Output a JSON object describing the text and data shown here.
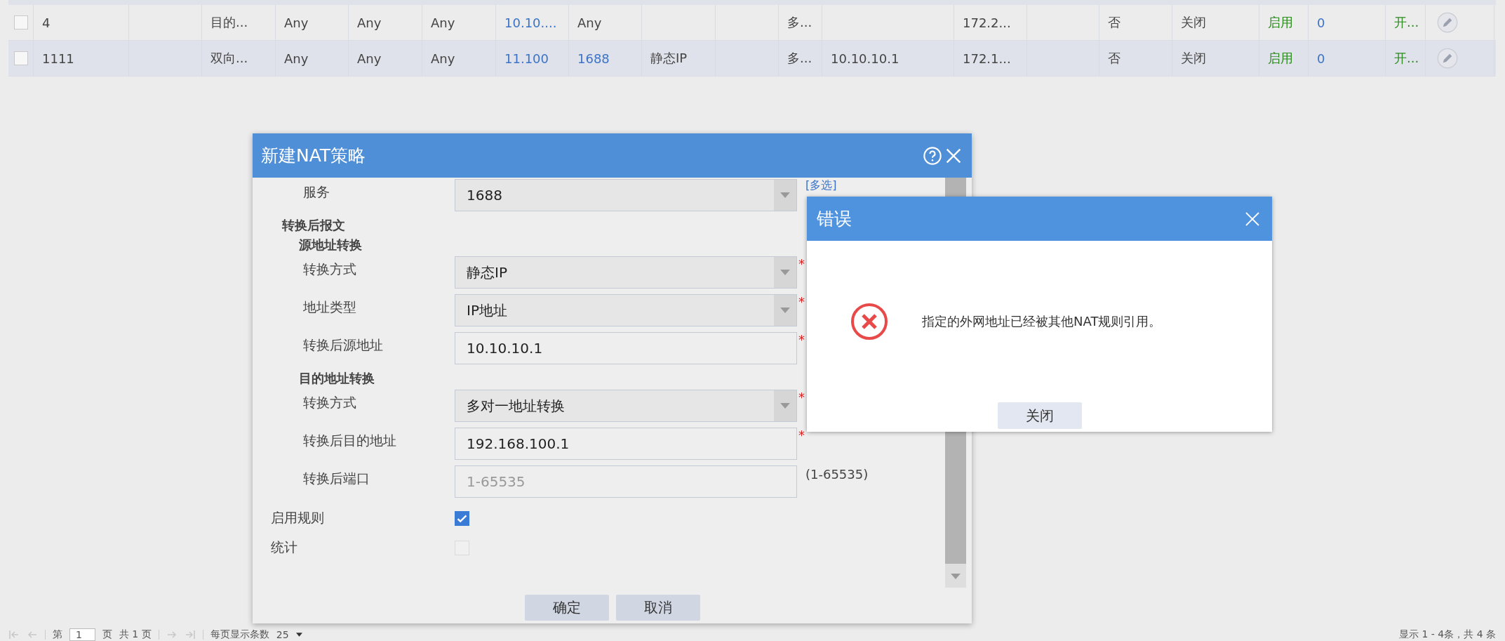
{
  "table": {
    "rows": [
      {
        "selected": false,
        "checked": false,
        "cells": [
          {
            "kind": "text",
            "text": "4"
          },
          {
            "kind": "text",
            "text": ""
          },
          {
            "kind": "text",
            "text": "目的..."
          },
          {
            "kind": "text",
            "text": "Any"
          },
          {
            "kind": "text",
            "text": "Any"
          },
          {
            "kind": "text",
            "text": "Any"
          },
          {
            "kind": "link",
            "text": "10.10...."
          },
          {
            "kind": "text",
            "text": "Any"
          },
          {
            "kind": "text",
            "text": ""
          },
          {
            "kind": "text",
            "text": ""
          },
          {
            "kind": "text",
            "text": "多..."
          },
          {
            "kind": "text",
            "text": ""
          },
          {
            "kind": "text",
            "text": "172.2..."
          },
          {
            "kind": "text",
            "text": ""
          },
          {
            "kind": "text",
            "text": "否"
          },
          {
            "kind": "text",
            "text": "关闭"
          },
          {
            "kind": "status",
            "text": "启用"
          },
          {
            "kind": "link",
            "text": "0"
          },
          {
            "kind": "status",
            "text": "开..."
          },
          {
            "kind": "edit"
          }
        ]
      },
      {
        "selected": true,
        "checked": false,
        "cells": [
          {
            "kind": "text",
            "text": "1111"
          },
          {
            "kind": "text",
            "text": ""
          },
          {
            "kind": "text",
            "text": "双向..."
          },
          {
            "kind": "text",
            "text": "Any"
          },
          {
            "kind": "text",
            "text": "Any"
          },
          {
            "kind": "text",
            "text": "Any"
          },
          {
            "kind": "link",
            "text": "11.100"
          },
          {
            "kind": "link",
            "text": "1688"
          },
          {
            "kind": "text",
            "text": "静态IP"
          },
          {
            "kind": "text",
            "text": ""
          },
          {
            "kind": "text",
            "text": "多..."
          },
          {
            "kind": "text",
            "text": "10.10.10.1"
          },
          {
            "kind": "text",
            "text": "172.1..."
          },
          {
            "kind": "text",
            "text": ""
          },
          {
            "kind": "text",
            "text": "否"
          },
          {
            "kind": "text",
            "text": "关闭"
          },
          {
            "kind": "status",
            "text": "启用"
          },
          {
            "kind": "link",
            "text": "0"
          },
          {
            "kind": "status",
            "text": "开..."
          },
          {
            "kind": "edit"
          }
        ]
      }
    ]
  },
  "nat_dialog": {
    "title": "新建NAT策略",
    "fields": [
      {
        "kind": "select",
        "label": "服务",
        "value": "1688",
        "link": "[多选]"
      },
      {
        "kind": "section",
        "label": "转换后报文"
      },
      {
        "kind": "subsection",
        "label": "源地址转换"
      },
      {
        "kind": "select",
        "label": "转换方式",
        "value": "静态IP",
        "required_mark": "*"
      },
      {
        "kind": "select",
        "label": "地址类型",
        "value": "IP地址",
        "required_mark": "*"
      },
      {
        "kind": "input",
        "label": "转换后源地址",
        "value": "10.10.10.1",
        "required_mark": "*"
      },
      {
        "kind": "subsection",
        "label": "目的地址转换"
      },
      {
        "kind": "select",
        "label": "转换方式",
        "value": "多对一地址转换",
        "required_mark": "*"
      },
      {
        "kind": "input",
        "label": "转换后目的地址",
        "value": "192.168.100.1",
        "required_mark": "*"
      },
      {
        "kind": "input",
        "label": "转换后端口",
        "placeholder": "1-65535",
        "note": "(1-65535)"
      },
      {
        "kind": "checkbox",
        "label": "启用规则",
        "checked": true,
        "disabled": false
      },
      {
        "kind": "checkbox",
        "label": "统计",
        "checked": false,
        "disabled": true
      }
    ],
    "buttons": [
      "确定",
      "取消"
    ]
  },
  "error_dialog": {
    "title": "错误",
    "message": "指定的外网地址已经被其他NAT规则引用。",
    "button": "关闭"
  },
  "pager": {
    "page_prefix": "第",
    "page": "1",
    "page_suffix": "页",
    "total_pages": "共 1 页",
    "per_page_label": "每页显示条数",
    "per_page": "25",
    "summary": "显示 1 - 4条，共 4 条"
  }
}
